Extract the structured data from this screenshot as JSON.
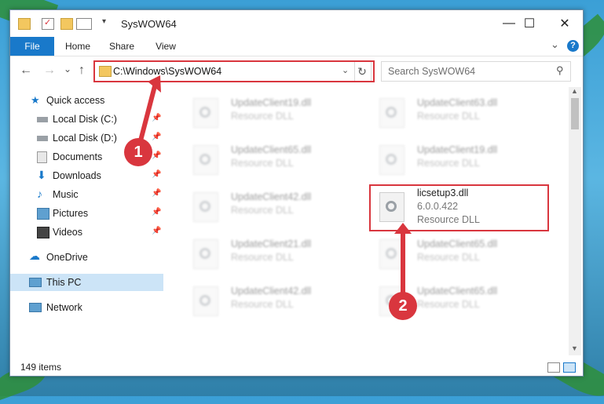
{
  "window": {
    "title": "SysWOW64",
    "controls": {
      "minimize": "—",
      "maximize": "☐",
      "close": "✕"
    }
  },
  "ribbon": {
    "tabs": [
      "File",
      "Home",
      "Share",
      "View"
    ],
    "help_icon": "?",
    "collapse_icon": "⌄"
  },
  "nav": {
    "back": "←",
    "forward": "→",
    "recent": "⌄",
    "up": "↑",
    "address": "C:\\Windows\\SysWOW64",
    "refresh": "↻",
    "search_placeholder": "Search SysWOW64"
  },
  "sidebar": {
    "items": [
      {
        "label": "Quick access",
        "icon": "star-icon",
        "pinned": false
      },
      {
        "label": "Local Disk (C:)",
        "icon": "drive-icon",
        "pinned": true
      },
      {
        "label": "Local Disk (D:)",
        "icon": "drive-icon",
        "pinned": true
      },
      {
        "label": "Documents",
        "icon": "documents-icon",
        "pinned": true
      },
      {
        "label": "Downloads",
        "icon": "download-icon",
        "pinned": true
      },
      {
        "label": "Music",
        "icon": "music-icon",
        "pinned": true
      },
      {
        "label": "Pictures",
        "icon": "pictures-icon",
        "pinned": true
      },
      {
        "label": "Videos",
        "icon": "videos-icon",
        "pinned": true
      },
      {
        "label": "OneDrive",
        "icon": "cloud-icon",
        "pinned": false
      },
      {
        "label": "This PC",
        "icon": "pc-icon",
        "pinned": false,
        "selected": true
      },
      {
        "label": "Network",
        "icon": "network-icon",
        "pinned": false
      }
    ]
  },
  "files": [
    {
      "name": "UpdateClient19.dll",
      "type": "Resource DLL",
      "blurred": true
    },
    {
      "name": "UpdateClient63.dll",
      "type": "Resource DLL",
      "blurred": true
    },
    {
      "name": "UpdateClient65.dll",
      "type": "Resource DLL",
      "blurred": true
    },
    {
      "name": "UpdateClient19.dll",
      "type": "Resource DLL",
      "blurred": true
    },
    {
      "name": "UpdateClient42.dll",
      "type": "Resource DLL",
      "blurred": true
    },
    {
      "name": "licsetup3.dll",
      "version": "6.0.0.422",
      "type": "Resource DLL",
      "blurred": false
    },
    {
      "name": "UpdateClient21.dll",
      "type": "Resource DLL",
      "blurred": true
    },
    {
      "name": "UpdateClient65.dll",
      "type": "Resource DLL",
      "blurred": true
    },
    {
      "name": "UpdateClient42.dll",
      "type": "Resource DLL",
      "blurred": true
    },
    {
      "name": "UpdateClient65.dll",
      "type": "Resource DLL",
      "blurred": true
    }
  ],
  "status": {
    "count": "149 items"
  },
  "annotations": {
    "step1": "1",
    "step2": "2"
  },
  "colors": {
    "accent": "#1979ca",
    "highlight": "#d9363e",
    "selection": "#cce4f7"
  }
}
